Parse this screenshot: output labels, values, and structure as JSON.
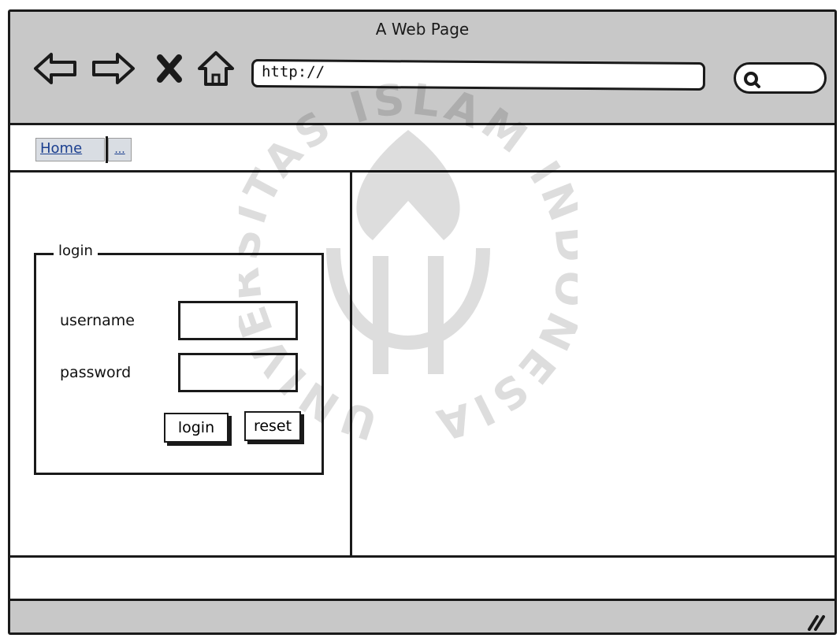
{
  "window": {
    "title": "A Web Page"
  },
  "toolbar": {
    "icons": [
      "back-icon",
      "forward-icon",
      "stop-icon",
      "home-icon"
    ],
    "url_value": "http://",
    "search_icon": "search-icon"
  },
  "tabs": [
    {
      "label": "Home"
    },
    {
      "label": "..."
    }
  ],
  "login": {
    "legend": "login",
    "username_label": "username",
    "password_label": "password",
    "username_value": "",
    "password_value": "",
    "login_button": "login",
    "reset_button": "reset"
  },
  "watermark": {
    "ring_text": "UNIVERSITAS ISLAM INDONESIA"
  },
  "statusbar": {
    "grip_icon": "resize-grip-icon"
  },
  "colors": {
    "chrome": "#c8c8c8",
    "border": "#1a1a1a",
    "link": "#1b3f8f"
  }
}
